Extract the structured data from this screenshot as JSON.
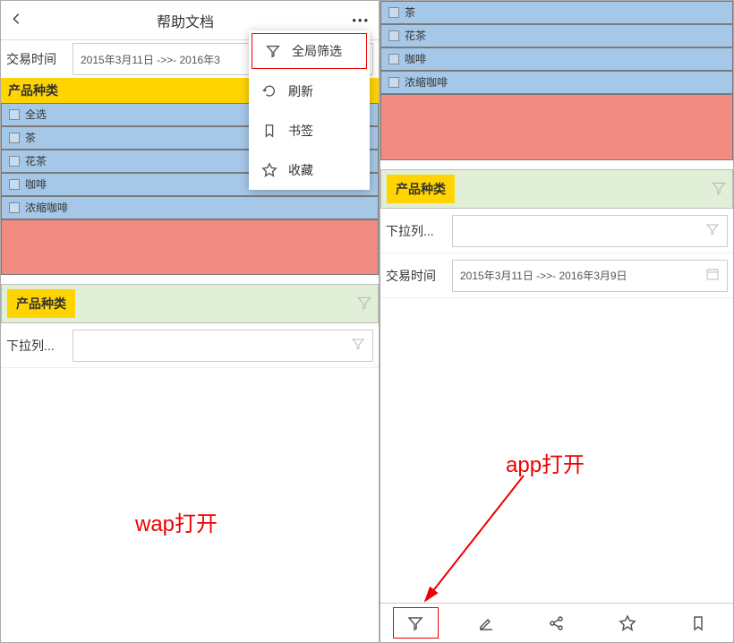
{
  "left": {
    "header_title": "帮助文档",
    "date_range_label": "交易时间",
    "date_range_value": "2015年3月11日 ->>- 2016年3",
    "product_heading": "产品种类",
    "rows": [
      "全选",
      "茶",
      "花茶",
      "咖啡",
      "浓缩咖啡"
    ],
    "filter_chip": "产品种类",
    "dropdown_label": "下拉列...",
    "menu_items": [
      "全局筛选",
      "刷新",
      "书签",
      "收藏"
    ],
    "caption": "wap打开"
  },
  "right": {
    "rows": [
      "茶",
      "花茶",
      "咖啡",
      "浓缩咖啡"
    ],
    "filter_chip": "产品种类",
    "dropdown_label": "下拉列...",
    "date_range_label": "交易时间",
    "date_range_value": "2015年3月11日 ->>- 2016年3月9日",
    "caption": "app打开"
  }
}
